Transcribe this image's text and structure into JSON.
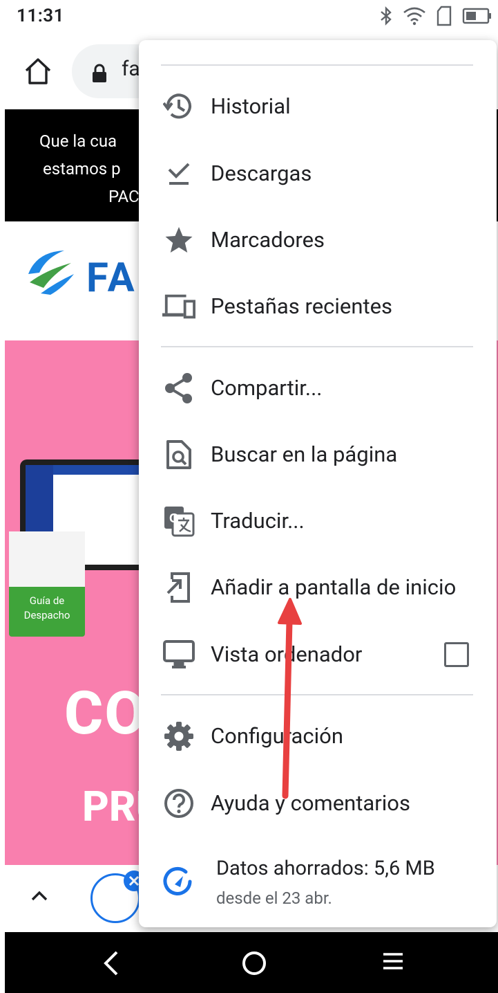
{
  "status_bar": {
    "time": "11:31",
    "icons": [
      "bluetooth-icon",
      "wifi-icon",
      "sim-icon",
      "battery-icon"
    ]
  },
  "toolbar": {
    "url_fragment": "fa"
  },
  "page_behind": {
    "banner_lines": [
      "Que la cua",
      "estamos p",
      "PAC"
    ],
    "brand_fragment": "FA",
    "product_label": "Guía de Despacho",
    "hero_text_1": "CO",
    "hero_text_2": "PRU"
  },
  "menu": {
    "items": [
      {
        "label": "Historial",
        "icon": "history-icon"
      },
      {
        "label": "Descargas",
        "icon": "download-check-icon"
      },
      {
        "label": "Marcadores",
        "icon": "star-icon"
      },
      {
        "label": "Pestañas recientes",
        "icon": "devices-icon"
      },
      {
        "label": "Compartir...",
        "icon": "share-icon"
      },
      {
        "label": "Buscar en la página",
        "icon": "find-in-page-icon"
      },
      {
        "label": "Traducir...",
        "icon": "translate-icon"
      },
      {
        "label": "Añadir a pantalla de inicio",
        "icon": "add-to-home-icon"
      },
      {
        "label": "Vista ordenador",
        "icon": "desktop-icon",
        "checked": false
      },
      {
        "label": "Configuración",
        "icon": "gear-icon"
      },
      {
        "label": "Ayuda y comentarios",
        "icon": "help-icon"
      }
    ],
    "data_saver": {
      "title": "Datos ahorrados: 5,6 MB",
      "subtitle": "desde el 23 abr.",
      "icon": "data-saver-icon"
    }
  },
  "colors": {
    "accent": "#1a73e8",
    "annotation": "#e84040",
    "page_pink": "#f97fae"
  }
}
